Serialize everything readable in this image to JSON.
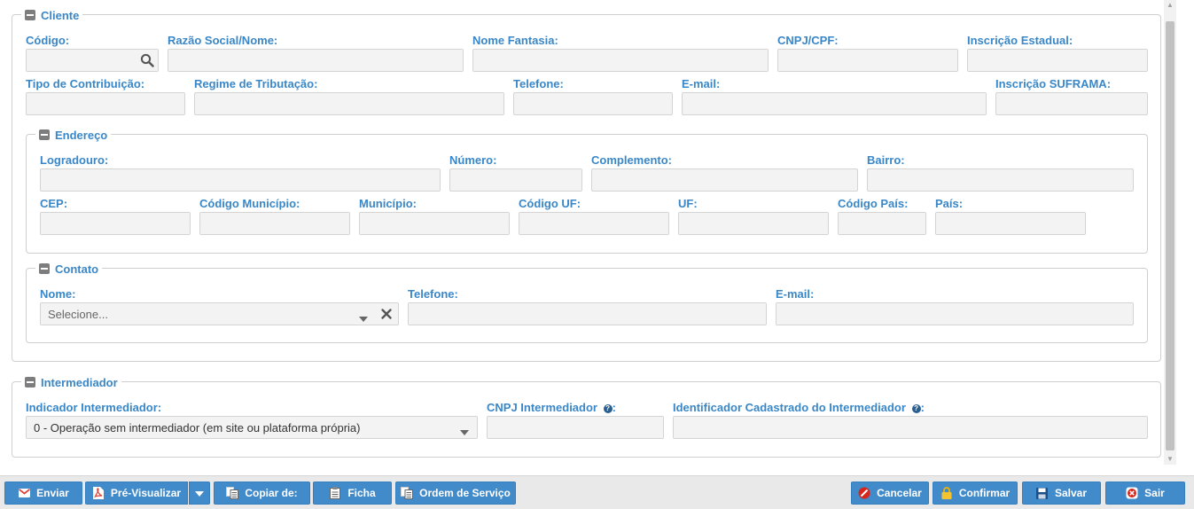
{
  "cliente": {
    "legend": "Cliente",
    "codigo_label": "Código:",
    "razao_label": "Razão Social/Nome:",
    "fantasia_label": "Nome Fantasia:",
    "cnpj_label": "CNPJ/CPF:",
    "ie_label": "Inscrição Estadual:",
    "tipo_contrib_label": "Tipo de Contribuição:",
    "regime_label": "Regime de Tributação:",
    "telefone_label": "Telefone:",
    "email_label": "E-mail:",
    "suframa_label": "Inscrição SUFRAMA:"
  },
  "endereco": {
    "legend": "Endereço",
    "logradouro_label": "Logradouro:",
    "numero_label": "Número:",
    "complemento_label": "Complemento:",
    "bairro_label": "Bairro:",
    "cep_label": "CEP:",
    "cod_municipio_label": "Código Município:",
    "municipio_label": "Município:",
    "cod_uf_label": "Código UF:",
    "uf_label": "UF:",
    "cod_pais_label": "Código País:",
    "pais_label": "País:"
  },
  "contato": {
    "legend": "Contato",
    "nome_label": "Nome:",
    "nome_placeholder": "Selecione...",
    "telefone_label": "Telefone:",
    "email_label": "E-mail:"
  },
  "intermediador": {
    "legend": "Intermediador",
    "indicador_label": "Indicador Intermediador:",
    "indicador_value": "0 - Operação sem intermediador (em site ou plataforma própria)",
    "cnpj_label": "CNPJ Intermediador",
    "identificador_label": "Identificador Cadastrado do Intermediador",
    "colon": ":"
  },
  "toolbar": {
    "enviar": "Enviar",
    "pre_visualizar": "Pré-Visualizar",
    "copiar": "Copiar de:",
    "ficha": "Ficha",
    "ordem_servico": "Ordem de Serviço",
    "cancelar": "Cancelar",
    "confirmar": "Confirmar",
    "salvar": "Salvar",
    "sair": "Sair"
  },
  "colors": {
    "accent": "#3a87c8",
    "button": "#428bca"
  }
}
